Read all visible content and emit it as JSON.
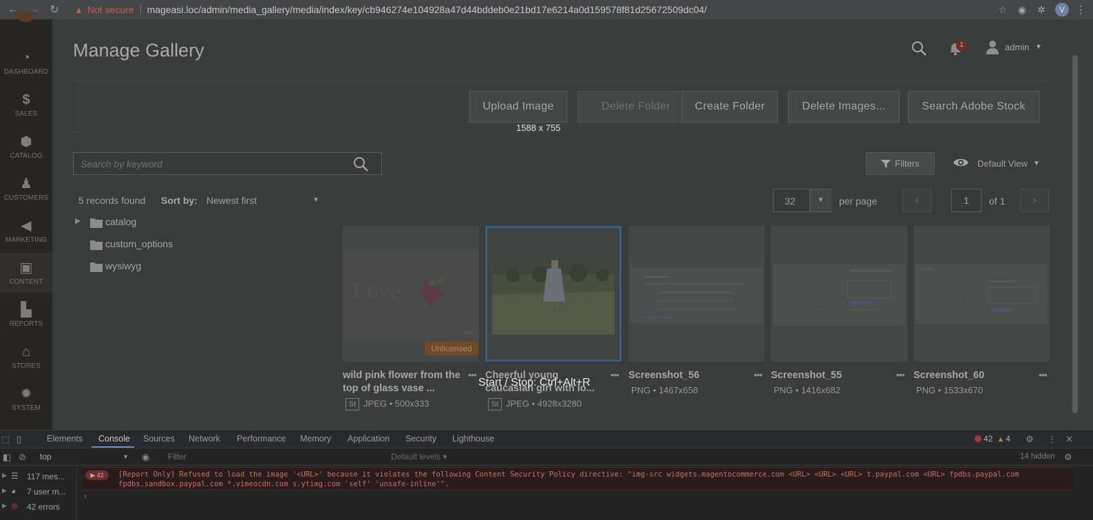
{
  "browser": {
    "back_icon": "back-arrow-icon",
    "not_secure": "Not secure",
    "url": "mageasi.loc/admin/media_gallery/media/index/key/cb946274e104928a47d44bddeb0e21bd17e6214a0d159578f81d25672509dc04/",
    "profile_initial": "V"
  },
  "sidebar": {
    "items": [
      {
        "label": "DASHBOARD",
        "icon": "dashboard-icon"
      },
      {
        "label": "SALES",
        "icon": "dollar-icon"
      },
      {
        "label": "CATALOG",
        "icon": "box-icon"
      },
      {
        "label": "CUSTOMERS",
        "icon": "person-icon"
      },
      {
        "label": "MARKETING",
        "icon": "megaphone-icon"
      },
      {
        "label": "CONTENT",
        "icon": "layout-icon"
      },
      {
        "label": "REPORTS",
        "icon": "bar-chart-icon"
      },
      {
        "label": "STORES",
        "icon": "store-icon"
      },
      {
        "label": "SYSTEM",
        "icon": "gear-icon"
      }
    ]
  },
  "header": {
    "title": "Manage Gallery",
    "notification_count": "1",
    "user": "admin"
  },
  "actions": {
    "upload": "Upload Image",
    "delete_folder": "Delete Folder",
    "create_folder": "Create Folder",
    "delete_images": "Delete Images...",
    "search_stock": "Search Adobe Stock"
  },
  "size_indicator": "1588 x 755",
  "search": {
    "placeholder": "Search by keyword"
  },
  "filters": {
    "label": "Filters",
    "view": "Default View"
  },
  "listing": {
    "records": "5 records found",
    "sort_label": "Sort by:",
    "sort_value": "Newest first",
    "per_page_value": "32",
    "per_page_label": "per page",
    "page": "1",
    "of_label": "of 1"
  },
  "folders": [
    {
      "name": "catalog",
      "expandable": true
    },
    {
      "name": "custom_options",
      "expandable": false
    },
    {
      "name": "wysiwyg",
      "expandable": false
    }
  ],
  "cards": [
    {
      "title": "wild pink flower from the top of glass vase ...",
      "meta": "JPEG • 500x333",
      "stock": "St",
      "badge": "Unlicensed"
    },
    {
      "title": "Cheerful young caucasian girl with lo...",
      "meta": "JPEG • 4928x3280",
      "stock": "St"
    },
    {
      "title": "Screenshot_56",
      "meta": "PNG • 1467x658"
    },
    {
      "title": "Screenshot_55",
      "meta": "PNG • 1416x682"
    },
    {
      "title": "Screenshot_60",
      "meta": "PNG • 1533x670"
    }
  ],
  "card_dots": "•••",
  "overlay": {
    "start_stop": "Start / Stop: Ctrl+Alt+R"
  },
  "devtools": {
    "tabs": [
      "Elements",
      "Console",
      "Sources",
      "Network",
      "Performance",
      "Memory",
      "Application",
      "Security",
      "Lighthouse"
    ],
    "active_tab": "Console",
    "error_count": "42",
    "warning_count": "4",
    "context": "top",
    "filter_placeholder": "Filter",
    "levels": "Default levels ▾",
    "hidden": "14 hidden",
    "sidebar": [
      {
        "label": "117 mes...",
        "icon": "list-icon"
      },
      {
        "label": "7 user m...",
        "icon": "user-circle-icon"
      },
      {
        "label": "42 errors",
        "icon": "error-icon"
      }
    ],
    "message_badge": "42",
    "message": "[Report Only] Refused to load the image '<URL>' because it violates the following Content Security Policy directive: \"img-src widgets.magentocommerce.com <URL> <URL> <URL> t.paypal.com <URL> fpdbs.paypal.com fpdbs.sandbox.paypal.com *.vimeocdn.com s.ytimg.com 'self' 'unsafe-inline'\".",
    "prompt": "›"
  }
}
